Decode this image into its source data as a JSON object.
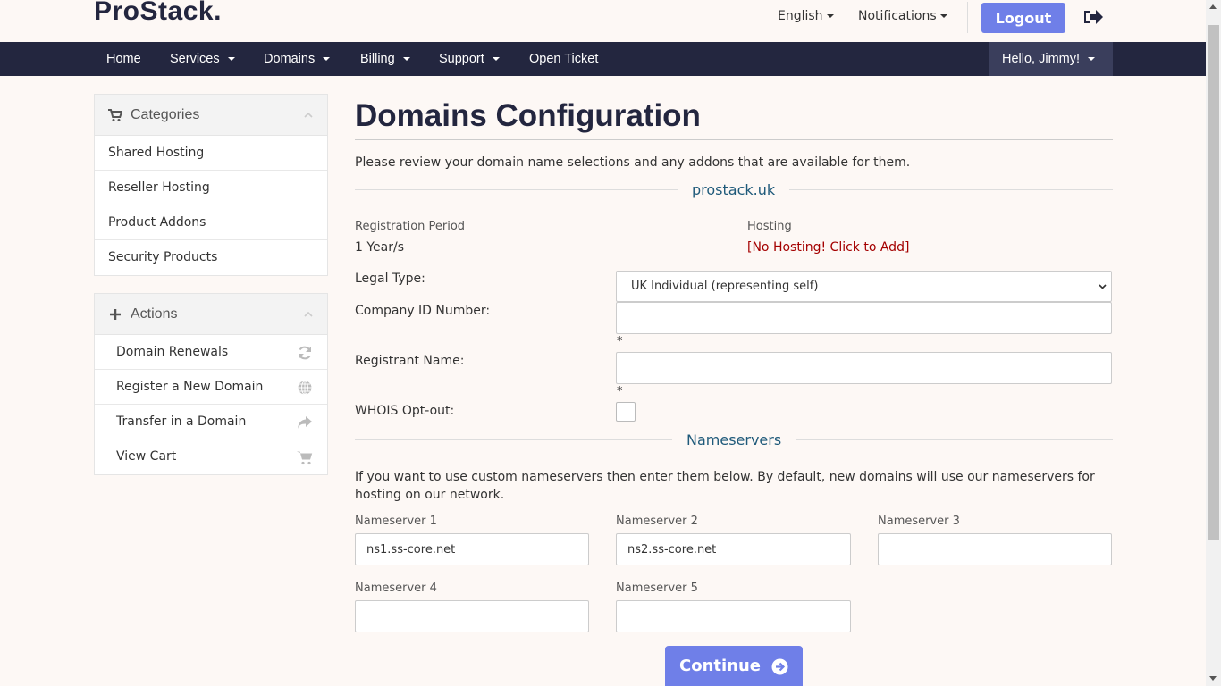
{
  "brand": {
    "name": "ProStack.",
    "trademark": "™"
  },
  "topbar": {
    "language": "English",
    "notifications": "Notifications",
    "logout": "Logout"
  },
  "nav": {
    "items": [
      "Home",
      "Services",
      "Domains",
      "Billing",
      "Support",
      "Open Ticket"
    ],
    "user": "Hello, Jimmy!"
  },
  "sidebar": {
    "categories": {
      "title": "Categories",
      "items": [
        "Shared Hosting",
        "Reseller Hosting",
        "Product Addons",
        "Security Products"
      ]
    },
    "actions": {
      "title": "Actions",
      "items": [
        "Domain Renewals",
        "Register a New Domain",
        "Transfer in a Domain",
        "View Cart"
      ]
    }
  },
  "main": {
    "title": "Domains Configuration",
    "intro": "Please review your domain name selections and any addons that are available for them.",
    "domain": "prostack.uk",
    "registration_period_label": "Registration Period",
    "registration_period_value": "1 Year/s",
    "hosting_label": "Hosting",
    "hosting_value": "[No Hosting! Click to Add]",
    "legal_type_label": "Legal Type:",
    "legal_type_value": "UK Individual (representing self)",
    "company_id_label": "Company ID Number:",
    "registrant_name_label": "Registrant Name:",
    "required_mark": "*",
    "whois_label": "WHOIS Opt-out:",
    "nameservers_heading": "Nameservers",
    "nameservers_intro": "If you want to use custom nameservers then enter them below. By default, new domains will use our nameservers for hosting on our network.",
    "nameservers": [
      {
        "label": "Nameserver 1",
        "value": "ns1.ss-core.net"
      },
      {
        "label": "Nameserver 2",
        "value": "ns2.ss-core.net"
      },
      {
        "label": "Nameserver 3",
        "value": ""
      },
      {
        "label": "Nameserver 4",
        "value": ""
      },
      {
        "label": "Nameserver 5",
        "value": ""
      }
    ],
    "continue": "Continue"
  },
  "colors": {
    "navbar": "#23263f",
    "accent": "#6f7fe8",
    "background": "#fdf8f5",
    "link_blue": "#1f5a7a",
    "warning_red": "#a40000"
  }
}
